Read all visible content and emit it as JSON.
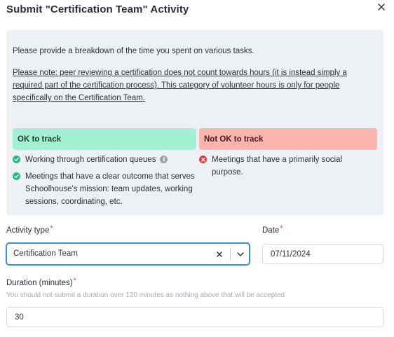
{
  "modal": {
    "title": "Submit \"Certification Team\" Activity",
    "close_icon": "close-icon"
  },
  "info": {
    "intro": "Please provide a breakdown of the time you spent on various tasks.",
    "note": "Please note: peer reviewing a certification does not count towards hours (it is instead simply a required part of the certification process). This category of volunteer hours is only for people specifically on the Certification Team."
  },
  "ok_to_track": {
    "title": "OK to track",
    "color": "#a4f0d3",
    "icon": "check-circle-icon",
    "items": [
      "Working through certification queues",
      "Meetings that have a clear outcome that serves Schoolhouse's mission: team updates, working sessions, coordinating, etc."
    ]
  },
  "not_ok_to_track": {
    "title": "Not OK to track",
    "color": "#fbb3ad",
    "icon": "x-circle-icon",
    "items": [
      "Meetings that have a primarily social purpose."
    ]
  },
  "activity_type": {
    "label": "Activity type",
    "required_mark": "*",
    "value": "Certification Team",
    "clear_icon": "clear-icon",
    "dropdown_icon": "chevron-down-icon"
  },
  "date": {
    "label": "Date",
    "required_mark": "*",
    "value": "07/11/2024"
  },
  "duration": {
    "label": "Duration (minutes)",
    "required_mark": "*",
    "hint": "You should not submit a duration over 120 minutes as nothing above that will be accepted",
    "value": "30"
  },
  "colors": {
    "accent": "#3a8dde",
    "required": "#e5484d",
    "panel_bg": "#edf1f5",
    "check": "#2fb880",
    "cross": "#d8403e"
  }
}
